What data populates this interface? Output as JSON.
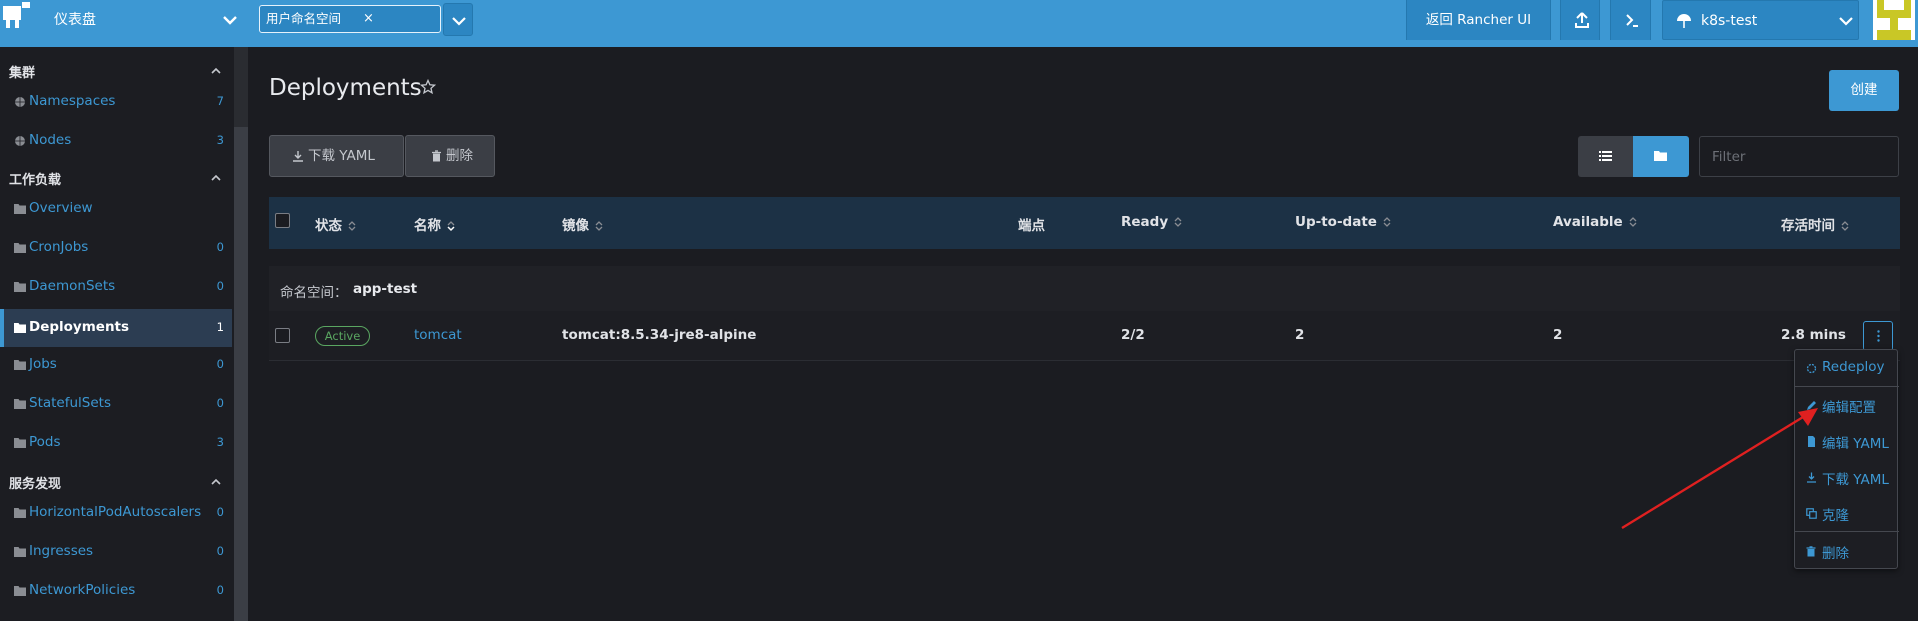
{
  "header": {
    "dashboard_label": "仪表盘",
    "namespace_tag": "用户命名空间",
    "namespace_tag_close": "×",
    "back_button": "返回 Rancher UI",
    "cluster_name": "k8s-test"
  },
  "sidebar": {
    "sections": [
      {
        "label": "集群"
      },
      {
        "label": "工作负载"
      },
      {
        "label": "服务发现"
      }
    ],
    "items": [
      {
        "label": "Namespaces",
        "count": "7",
        "icon": "globe-icon"
      },
      {
        "label": "Nodes",
        "count": "3",
        "icon": "globe-icon"
      },
      {
        "label": "Overview",
        "count": "",
        "icon": "folder-icon"
      },
      {
        "label": "CronJobs",
        "count": "0",
        "icon": "folder-icon"
      },
      {
        "label": "DaemonSets",
        "count": "0",
        "icon": "folder-icon"
      },
      {
        "label": "Deployments",
        "count": "1",
        "icon": "folder-open-icon",
        "active": true
      },
      {
        "label": "Jobs",
        "count": "0",
        "icon": "folder-icon"
      },
      {
        "label": "StatefulSets",
        "count": "0",
        "icon": "folder-icon"
      },
      {
        "label": "Pods",
        "count": "3",
        "icon": "folder-icon"
      },
      {
        "label": "HorizontalPodAutoscalers",
        "count": "0",
        "icon": "folder-icon"
      },
      {
        "label": "Ingresses",
        "count": "0",
        "icon": "folder-icon"
      },
      {
        "label": "NetworkPolicies",
        "count": "0",
        "icon": "folder-icon"
      }
    ]
  },
  "main": {
    "title": "Deployments",
    "create_button": "创建",
    "download_yaml_button": "下载 YAML",
    "delete_button": "删除",
    "filter_placeholder": "Filter",
    "table": {
      "columns": [
        "状态",
        "名称",
        "镜像",
        "端点",
        "Ready",
        "Up-to-date",
        "Available",
        "存活时间"
      ],
      "group_label": "命名空间：",
      "group_value": "app-test",
      "rows": [
        {
          "status": "Active",
          "name": "tomcat",
          "image": "tomcat:8.5.34-jre8-alpine",
          "endpoints": "",
          "ready": "2/2",
          "up_to_date": "2",
          "available": "2",
          "age": "2.8 mins"
        }
      ]
    },
    "action_menu": [
      {
        "label": "Redeploy",
        "icon": "redeploy-icon"
      },
      {
        "label": "编辑配置",
        "icon": "pencil-icon"
      },
      {
        "label": "编辑 YAML",
        "icon": "file-icon"
      },
      {
        "label": "下载 YAML",
        "icon": "download-icon"
      },
      {
        "label": "克隆",
        "icon": "copy-icon"
      },
      {
        "label": "删除",
        "icon": "trash-icon"
      }
    ]
  },
  "colors": {
    "header_bg": "#3d98d3",
    "accent": "#3d98d3",
    "active_status": "#5aa661",
    "annotation_arrow": "#e02020"
  }
}
